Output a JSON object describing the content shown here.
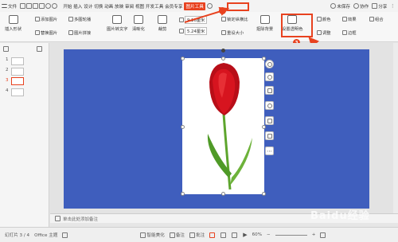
{
  "menubar": {
    "menu_label": "文件",
    "tabs_text": "开始 插入 设计 切换 动画 放映 审阅 视图 开发工具 会员专享",
    "picture_tools_tab": "图片工具",
    "unsaved_label": "未保存",
    "collab_label": "协作",
    "share_label": "分享"
  },
  "ribbon": {
    "insert_shape": "插入形状",
    "add_picture": "添加图片",
    "replace_picture": "替换图片",
    "multi_layout": "多图轮播",
    "picture_collage": "图片拼接",
    "crop": "裁剪",
    "width_value": "9.16厘米",
    "height_value": "5.24厘米",
    "lock_ratio": "锁定纵横比",
    "reset_size": "重设大小",
    "cutout_background": "抠除背景",
    "set_transparent_color": "设置透明色",
    "color": "颜色",
    "effects": "效果",
    "border": "边框",
    "group": "组合",
    "adjust": "调整",
    "picture_text": "图片转文字",
    "enhance": "清晰化"
  },
  "slides": {
    "numbers": [
      "1",
      "2",
      "3",
      "4"
    ],
    "selected_index": 3
  },
  "notes": {
    "placeholder": "单击此处添加备注"
  },
  "status": {
    "slide_info": "幻灯片 3 / 4",
    "theme": "Office 主题",
    "beautify": "智能美化",
    "notes_btn": "备注",
    "annotate_btn": "批注",
    "zoom": "60%"
  },
  "annotations": {
    "step1": "1",
    "step2": "2",
    "step3": "3"
  },
  "colors": {
    "accent": "#e8421f",
    "slide_bg": "#3f5ebd",
    "tulip_red": "#d7141f",
    "stem_green": "#5da52d"
  },
  "watermark": "Baidu经验"
}
